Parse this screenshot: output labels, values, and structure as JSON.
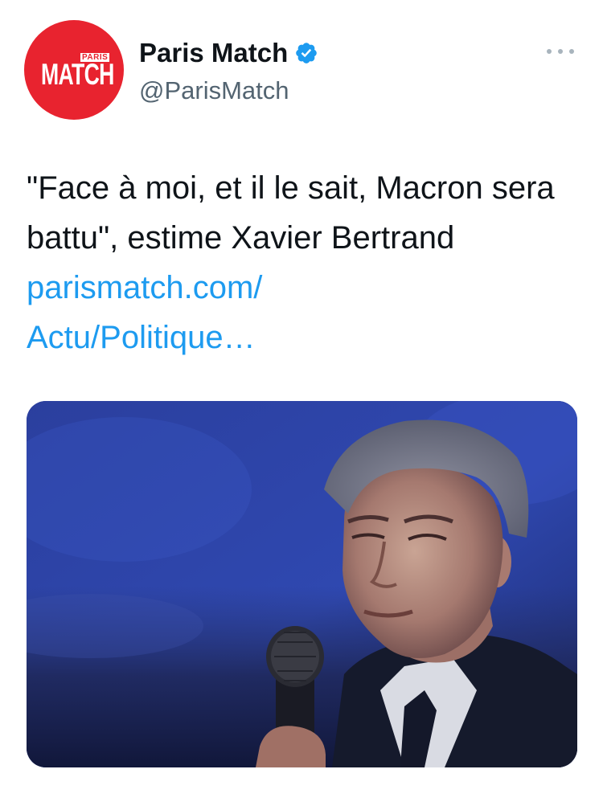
{
  "account": {
    "avatar_logo_top": "PARIS",
    "avatar_logo_main": "MATCH",
    "display_name": "Paris Match",
    "verified_icon": "verified-badge-icon",
    "handle": "@ParisMatch",
    "more_icon": "more-horizontal-icon"
  },
  "tweet": {
    "text": "\"Face à moi, et il le sait, Macron sera battu\", estime Xavier Bertrand ",
    "link_text": "parismatch.com/\nActu/Politique…"
  },
  "media": {
    "description_icon": "photo-xavier-bertrand"
  },
  "colors": {
    "brand_red": "#e8232f",
    "link_blue": "#1d9bf0",
    "verified_blue": "#1d9bf0",
    "text_primary": "#0f1419",
    "text_secondary": "#536471"
  }
}
